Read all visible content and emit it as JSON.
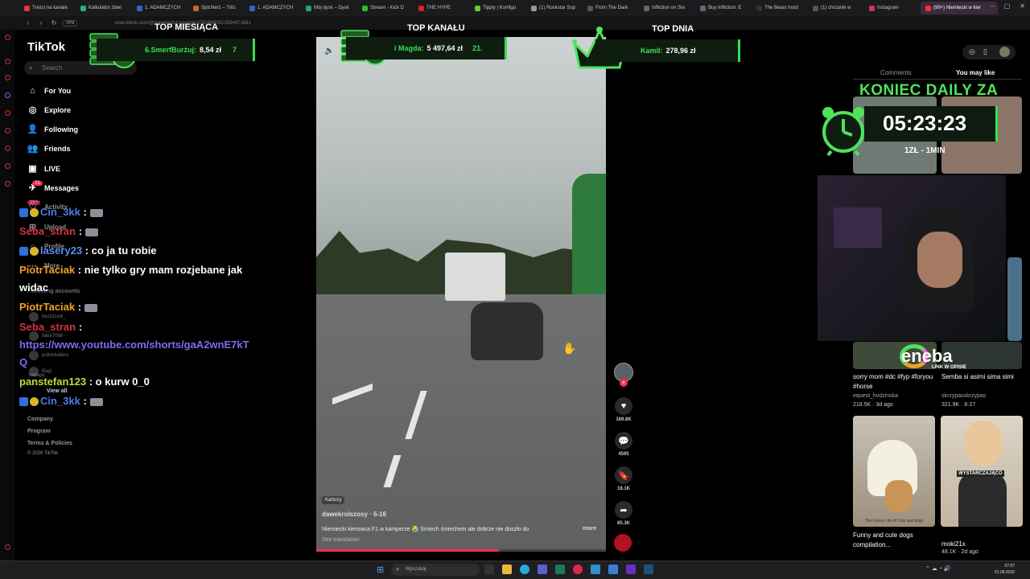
{
  "browser": {
    "tabs": [
      {
        "label": "Treści na kanale"
      },
      {
        "label": "Kalkulator zbiel"
      },
      {
        "label": "1. ADAMCZYCH"
      },
      {
        "label": "Spichlerz – Trits"
      },
      {
        "label": "1. ADAMCZYCH"
      },
      {
        "label": "Mój dysk – Dysk"
      },
      {
        "label": "Stream - Kick D"
      },
      {
        "label": "THE HYPE"
      },
      {
        "label": "Tipply | Konfigu"
      },
      {
        "label": "(1) Rockstar Sup"
      },
      {
        "label": "From The Dark"
      },
      {
        "label": "Infliction on Ste"
      },
      {
        "label": "Buy Infliction: E"
      },
      {
        "label": "The Beast Insid"
      },
      {
        "label": "(1) chrzanik w"
      },
      {
        "label": "Instagram"
      }
    ],
    "active_tab": "(99+) Niemiecki w kier",
    "vpn_label": "VPN",
    "url": "www.tiktok.com/@dawekrolszosy/video/7619690812694971681"
  },
  "tiktok": {
    "logo": "TikTok",
    "search_placeholder": "Search",
    "nav": [
      {
        "label": "For You",
        "icon": "home-icon"
      },
      {
        "label": "Explore",
        "icon": "compass-icon"
      },
      {
        "label": "Following",
        "icon": "following-icon"
      },
      {
        "label": "Friends",
        "icon": "friends-icon"
      },
      {
        "label": "LIVE",
        "icon": "live-icon"
      },
      {
        "label": "Messages",
        "icon": "messages-icon"
      },
      {
        "label": "Activity",
        "icon": "activity-icon"
      },
      {
        "label": "Upload",
        "icon": "upload-icon"
      },
      {
        "label": "Profile",
        "icon": "profile-icon"
      },
      {
        "label": "More",
        "icon": "more-icon"
      }
    ],
    "messages_badge": "71",
    "activity_badge": "99+",
    "following_accounts_label": "Following accounts",
    "following_accounts": [
      {
        "name": "bezszczel_"
      },
      {
        "name": "fabix7068"
      },
      {
        "name": "polishballers"
      },
      {
        "name": "Bagi"
      },
      {
        "name": "bebapy"
      }
    ],
    "view_all": "View all",
    "footer": [
      "Company",
      "Program",
      "Terms & Policies",
      "© 2026 TikTok"
    ]
  },
  "overlay": {
    "top_month_title": "TOP MIESIĄCA",
    "top_month_entry": "6.SmerfBurżuj:",
    "top_month_value": "8,54 zł",
    "top_month_extra": "7",
    "top_channel_title": "TOP KANAŁU",
    "top_channel_entry": "i Magda:",
    "top_channel_value": "5 497,64 zł",
    "top_channel_extra": "21.",
    "top_day_title": "TOP DNIA",
    "top_day_entry": "Kamil:",
    "top_day_value": "278,96 zł",
    "koniec": "KONIEC DAILY ZA",
    "timer": "05:23:23",
    "rate": "1ZŁ - 1MIN",
    "eneba": "eneba",
    "eneba_sub": "LINK W OPISIE"
  },
  "chat": [
    {
      "user": "Cin_3kk",
      "user_color": "#4a7de8",
      "text": ":",
      "emote": true
    },
    {
      "user": "Seba_stran",
      "user_color": "#d9313e",
      "text": ":",
      "emote": true
    },
    {
      "user": "lasery23",
      "user_color": "#5a8df0",
      "text": ": co ja tu robie"
    },
    {
      "user": "PiotrTaciak",
      "user_color": "#f0a12a",
      "text": ": nie tylko gry mam rozjebane jak"
    },
    {
      "user": "",
      "user_color": "#fff",
      "text": "widac"
    },
    {
      "user": "PiotrTaciak",
      "user_color": "#f0a12a",
      "text": ":",
      "emote": true
    },
    {
      "user": "Seba_stran",
      "user_color": "#d9313e",
      "text": ":"
    },
    {
      "user": "",
      "user_color": "#7a6df2",
      "text": "https://www.youtube.com/shorts/gaA2wnE7kT"
    },
    {
      "user": "",
      "user_color": "#7a6df2",
      "text": "Q"
    },
    {
      "user": "panstefan123",
      "user_color": "#b8e03a",
      "text": ": o kurw 0_0"
    },
    {
      "user": "Cin_3kk",
      "user_color": "#4a7de8",
      "text": ":",
      "emote": true
    }
  ],
  "video": {
    "location": "Kartuzy",
    "author": "dawekrolszosy",
    "date": "6-16",
    "description": "Niemiecki kierowca F1 w kamperze 😭 Śmiech śmiechem ale dobrze nie doszło do",
    "more": "more",
    "see_translation": "See translation",
    "progress": 0.63
  },
  "actions": [
    {
      "name": "like",
      "icon": "heart-icon",
      "count": "169.8K"
    },
    {
      "name": "comment",
      "icon": "comment-icon",
      "count": "4595"
    },
    {
      "name": "save",
      "icon": "bookmark-icon",
      "count": "18.1K"
    },
    {
      "name": "share",
      "icon": "share-icon",
      "count": "85.3K"
    }
  ],
  "right": {
    "tab_comments": "Comments",
    "tab_you_may_like": "You may like",
    "items": [
      {
        "title": "sorry mom #dc #fyp #foryou #horse",
        "author": "equest_hvdzinska",
        "stats": "218.5K · 3d ago"
      },
      {
        "title": "Semba si asimi sima simi",
        "author": "skrzypasskrzypas",
        "stats": "321.9K · 6-27"
      },
      {
        "title": "Funny and cute dogs compilation...",
        "author": "",
        "stats": ""
      },
      {
        "title": "moki21x",
        "author": "",
        "stats": "48.1K · 2d ago"
      }
    ],
    "thumb_caption_1": "WYSTARCZAJĄCO",
    "thumb_caption_2": "The Funny Life of Cats and dogs"
  },
  "taskbar": {
    "search": "Wyszukaj",
    "time": "07:07",
    "date": "01.08.2026"
  }
}
